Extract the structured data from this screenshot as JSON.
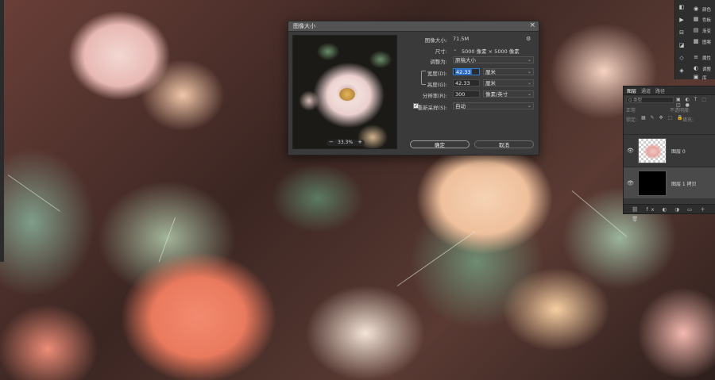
{
  "dialog": {
    "title": "图像大小",
    "close": "×",
    "image_size_label": "图像大小:",
    "image_size_value": "71.5M",
    "dimensions_label": "尺寸:",
    "dimensions_value": "5000 像素 × 5000 像素",
    "fit_to_label": "调整为:",
    "fit_to_value": "原稿大小",
    "width_label": "宽度(D):",
    "width_value": "42.33",
    "width_unit": "厘米",
    "height_label": "高度(G):",
    "height_value": "42.33",
    "height_unit": "厘米",
    "resolution_label": "分辨率(R):",
    "resolution_value": "300",
    "resolution_unit": "像素/英寸",
    "resample_label": "重新采样(S):",
    "resample_value": "自动",
    "resample_checked": true,
    "ok": "确定",
    "cancel": "取消",
    "preview_zoom": "33.3%",
    "zoom_minus": "−",
    "zoom_plus": "+",
    "checkmark": "✓",
    "gear_glyph": "⚙",
    "arrow_glyph": "⌄",
    "dim_arrow": "⌄"
  },
  "right_toolbar": {
    "items": [
      {
        "icon": "color-icon",
        "glyph": "◉",
        "label": "颜色"
      },
      {
        "icon": "swatches-icon",
        "glyph": "▦",
        "label": "色板"
      },
      {
        "icon": "gradient-icon",
        "glyph": "▤",
        "label": "渐变"
      },
      {
        "icon": "pattern-icon",
        "glyph": "▩",
        "label": "图案"
      },
      {
        "icon": "properties-icon",
        "glyph": "≡",
        "label": "属性"
      },
      {
        "icon": "adjustments-icon",
        "glyph": "◐",
        "label": "调整"
      },
      {
        "icon": "libraries-icon",
        "glyph": "▣",
        "label": "库"
      }
    ],
    "tool_glyphs": [
      "◧",
      "▶",
      "⊟",
      "◪",
      "◇",
      "◈",
      "◫"
    ]
  },
  "layers_panel": {
    "tabs": [
      "图层",
      "通道",
      "路径"
    ],
    "search_placeholder": "Q 类型",
    "filter_icons": "▣ ◐ T ⬚ ◫ ●",
    "blend_mode": "正常",
    "opacity_label": "不透明度:",
    "lock_label": "锁定:",
    "lock_icons": "▦ ✎ ✥ ⬚ 🔒",
    "fill_label": "填充:",
    "layers": [
      {
        "name": "图层 0",
        "visible": true
      },
      {
        "name": "图层 1 拷贝",
        "visible": true
      }
    ],
    "eye_glyph": "👁",
    "footer_icons": "⛓ fx ◐ ◑ ▭ ＋ 🗑"
  },
  "colors": {
    "dialog_bg": "#3a3a3a",
    "accent": "#2d7cd6",
    "panel_bg": "#383838"
  }
}
